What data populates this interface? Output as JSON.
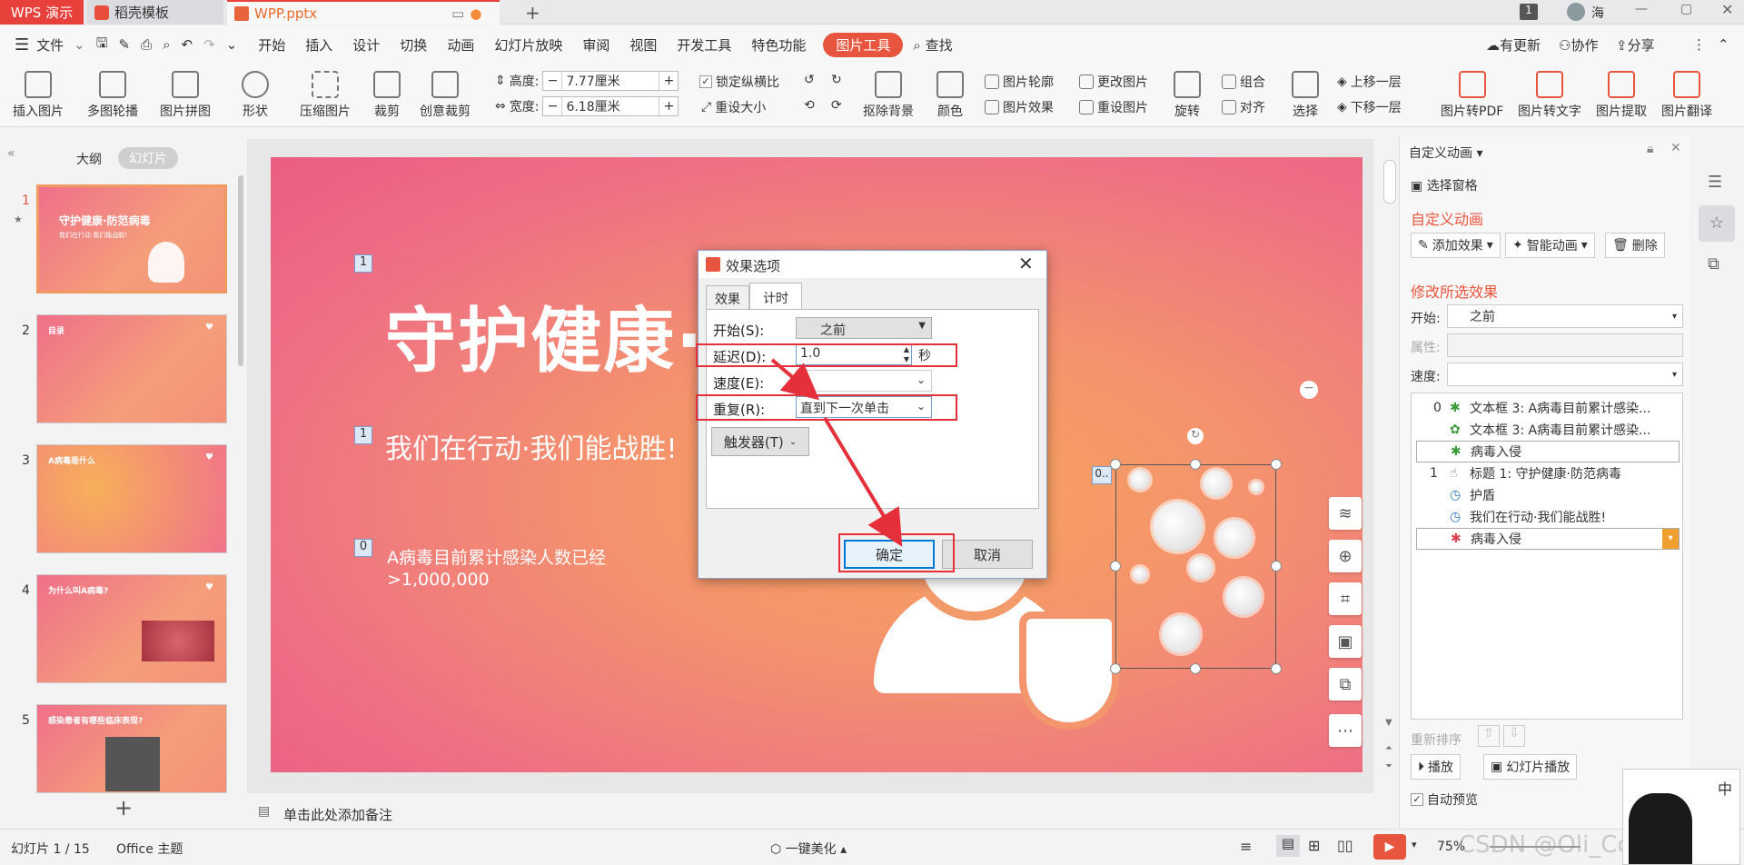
{
  "titlebar": {
    "app": "WPS 演示",
    "tab_template": "稻壳模板",
    "tab_file": "WPP.pptx",
    "page_indicator": "1",
    "user": "海"
  },
  "menu": {
    "file": "文件",
    "items": [
      "开始",
      "插入",
      "设计",
      "切换",
      "动画",
      "幻灯片放映",
      "审阅",
      "视图",
      "开发工具",
      "特色功能"
    ],
    "active": "图片工具",
    "search": "查找",
    "update": "有更新",
    "collab": "协作",
    "share": "分享"
  },
  "ribbon": {
    "insert_pic": "插入图片",
    "multi_rotate": "多图轮播",
    "pic_collage": "图片拼图",
    "shape": "形状",
    "compress": "压缩图片",
    "crop": "裁剪",
    "creative_crop": "创意裁剪",
    "height_label": "高度:",
    "height_value": "7.77厘米",
    "width_label": "宽度:",
    "width_value": "6.18厘米",
    "lock_ratio": "锁定纵横比",
    "reset_size": "重设大小",
    "remove_bg": "抠除背景",
    "color": "颜色",
    "pic_outline": "图片轮廓",
    "pic_effect": "图片效果",
    "change_pic": "更改图片",
    "reset_pic": "重设图片",
    "rotate": "旋转",
    "group": "组合",
    "align": "对齐",
    "select": "选择",
    "bring_forward": "上移一层",
    "send_backward": "下移一层",
    "to_pdf": "图片转PDF",
    "to_text": "图片转文字",
    "extract": "图片提取",
    "translate": "图片翻译"
  },
  "left_pane": {
    "tab_outline": "大纲",
    "tab_slides": "幻灯片",
    "slides": [
      {
        "num": "1",
        "title": "守护健康·防范病毒",
        "sub": "我们在行动·我们能战胜!"
      },
      {
        "num": "2",
        "title": "目录",
        "sub": ""
      },
      {
        "num": "3",
        "title": "A病毒是什么",
        "sub": ""
      },
      {
        "num": "4",
        "title": "为什么叫A病毒?",
        "sub": ""
      },
      {
        "num": "5",
        "title": "感染患者有哪些临床表现?",
        "sub": ""
      }
    ]
  },
  "slide": {
    "title": "守护健康·",
    "subtitle": "我们在行动·我们能战胜!",
    "body1": "A病毒目前累计感染人数已经",
    "body2": ">1,000,000",
    "tag1": "1",
    "tag2": "1",
    "tag3": "0",
    "tag4": "0.."
  },
  "notes": "单击此处添加备注",
  "dialog": {
    "title": "效果选项",
    "tab_effect": "效果",
    "tab_timing": "计时",
    "start_label": "开始(S):",
    "start_value": "之前",
    "delay_label": "延迟(D):",
    "delay_value": "1.0",
    "delay_unit": "秒",
    "speed_label": "速度(E):",
    "repeat_label": "重复(R):",
    "repeat_value": "直到下一次单击",
    "trigger": "触发器(T)",
    "ok": "确定",
    "cancel": "取消"
  },
  "right_pane": {
    "header": "自定义动画",
    "select_pane": "选择窗格",
    "section1": "自定义动画",
    "add_effect": "添加效果",
    "smart_anim": "智能动画",
    "delete": "删除",
    "section2": "修改所选效果",
    "start_label": "开始:",
    "start_value": "之前",
    "prop_label": "属性:",
    "speed_label": "速度:",
    "list": [
      {
        "idx": "0",
        "text": "文本框 3: A病毒目前累计感染..."
      },
      {
        "idx": "",
        "text": "文本框 3: A病毒目前累计感染..."
      },
      {
        "idx": "",
        "text": "病毒入侵"
      },
      {
        "idx": "1",
        "text": "标题 1: 守护健康·防范病毒"
      },
      {
        "idx": "",
        "text": "护盾"
      },
      {
        "idx": "",
        "text": "我们在行动·我们能战胜!"
      },
      {
        "idx": "",
        "text": "病毒入侵"
      }
    ],
    "reorder": "重新排序",
    "play": "播放",
    "slideshow": "幻灯片播放",
    "auto_preview": "自动预览"
  },
  "status": {
    "slide_count": "幻灯片 1 / 15",
    "theme": "Office 主题",
    "beautify": "一键美化",
    "zoom": "75%",
    "watermark": "CSDN @Oli_Correc",
    "ime": "中"
  }
}
